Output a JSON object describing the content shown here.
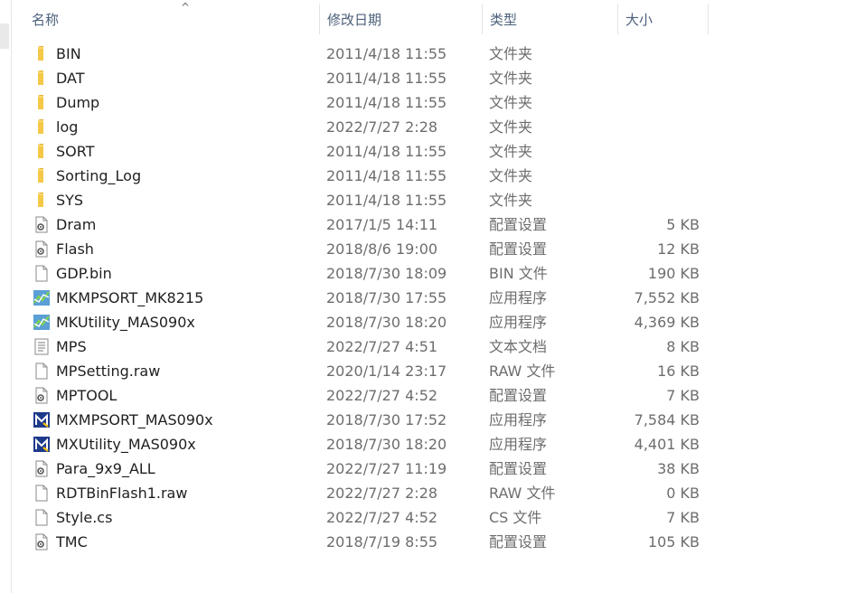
{
  "columns": {
    "name": "名称",
    "date": "修改日期",
    "type": "类型",
    "size": "大小"
  },
  "files": [
    {
      "name": "BIN",
      "date": "2011/4/18 11:55",
      "type": "文件夹",
      "size": "",
      "icon": "folder-icon"
    },
    {
      "name": "DAT",
      "date": "2011/4/18 11:55",
      "type": "文件夹",
      "size": "",
      "icon": "folder-icon"
    },
    {
      "name": "Dump",
      "date": "2011/4/18 11:55",
      "type": "文件夹",
      "size": "",
      "icon": "folder-icon"
    },
    {
      "name": "log",
      "date": "2022/7/27 2:28",
      "type": "文件夹",
      "size": "",
      "icon": "folder-icon"
    },
    {
      "name": "SORT",
      "date": "2011/4/18 11:55",
      "type": "文件夹",
      "size": "",
      "icon": "folder-icon"
    },
    {
      "name": "Sorting_Log",
      "date": "2011/4/18 11:55",
      "type": "文件夹",
      "size": "",
      "icon": "folder-icon"
    },
    {
      "name": "SYS",
      "date": "2011/4/18 11:55",
      "type": "文件夹",
      "size": "",
      "icon": "folder-icon"
    },
    {
      "name": "Dram",
      "date": "2017/1/5 14:11",
      "type": "配置设置",
      "size": "5 KB",
      "icon": "config-file-icon"
    },
    {
      "name": "Flash",
      "date": "2018/8/6 19:00",
      "type": "配置设置",
      "size": "12 KB",
      "icon": "config-file-icon"
    },
    {
      "name": "GDP.bin",
      "date": "2018/7/30 18:09",
      "type": "BIN 文件",
      "size": "190 KB",
      "icon": "blank-file-icon"
    },
    {
      "name": "MKMPSORT_MK8215",
      "date": "2018/7/30 17:55",
      "type": "应用程序",
      "size": "7,552 KB",
      "icon": "mk-app-icon"
    },
    {
      "name": "MKUtility_MAS090x",
      "date": "2018/7/30 18:20",
      "type": "应用程序",
      "size": "4,369 KB",
      "icon": "mk-app-icon"
    },
    {
      "name": "MPS",
      "date": "2022/7/27 4:51",
      "type": "文本文档",
      "size": "8 KB",
      "icon": "text-file-icon"
    },
    {
      "name": "MPSetting.raw",
      "date": "2020/1/14 23:17",
      "type": "RAW 文件",
      "size": "16 KB",
      "icon": "blank-file-icon"
    },
    {
      "name": "MPTOOL",
      "date": "2022/7/27 4:52",
      "type": "配置设置",
      "size": "7 KB",
      "icon": "config-file-icon"
    },
    {
      "name": "MXMPSORT_MAS090x",
      "date": "2018/7/30 17:52",
      "type": "应用程序",
      "size": "7,584 KB",
      "icon": "mx-app-icon"
    },
    {
      "name": "MXUtility_MAS090x",
      "date": "2018/7/30 18:20",
      "type": "应用程序",
      "size": "4,401 KB",
      "icon": "mx-app-icon"
    },
    {
      "name": "Para_9x9_ALL",
      "date": "2022/7/27 11:19",
      "type": "配置设置",
      "size": "38 KB",
      "icon": "config-file-icon"
    },
    {
      "name": "RDTBinFlash1.raw",
      "date": "2022/7/27 2:28",
      "type": "RAW 文件",
      "size": "0 KB",
      "icon": "blank-file-icon"
    },
    {
      "name": "Style.cs",
      "date": "2022/7/27 4:52",
      "type": "CS 文件",
      "size": "7 KB",
      "icon": "blank-file-icon"
    },
    {
      "name": "TMC",
      "date": "2018/7/19 8:55",
      "type": "配置设置",
      "size": "105 KB",
      "icon": "config-file-icon"
    }
  ],
  "colors": {
    "header_text": "#4c607a",
    "folder": "#f5c847",
    "mk_blue": "#3a7bd5",
    "mx_navy": "#1e3a8a",
    "mx_yellow": "#f4c20d"
  }
}
